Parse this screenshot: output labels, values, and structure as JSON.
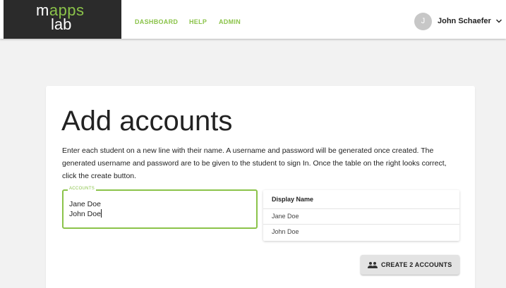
{
  "brand": {
    "line1_prefix": "m",
    "line1_accent": "apps",
    "line2": "lab"
  },
  "nav": {
    "items": [
      "DASHBOARD",
      "HELP",
      "ADMIN"
    ]
  },
  "user": {
    "initial": "J",
    "name": "John Schaefer"
  },
  "page": {
    "title": "Add accounts",
    "description": "Enter each student on a new line with their name. A username and password will be generated once created. The generated username and password are to be given to the student to sign In. Once the table on the right looks correct, click the create button."
  },
  "accounts_field": {
    "label": "ACCOUNTS",
    "lines": [
      "Jane Doe",
      "John Doe"
    ]
  },
  "preview_table": {
    "header": "Display Name",
    "rows": [
      "Jane Doe",
      "John Doe"
    ]
  },
  "create_button": {
    "label": "CREATE 2 ACCOUNTS"
  },
  "colors": {
    "accent": "#8bc34a",
    "logo_bg": "#2b2b2b",
    "page_bg": "#f2f2f2"
  },
  "icons": {
    "user_menu": "chevron-down-icon",
    "create": "group-icon"
  }
}
